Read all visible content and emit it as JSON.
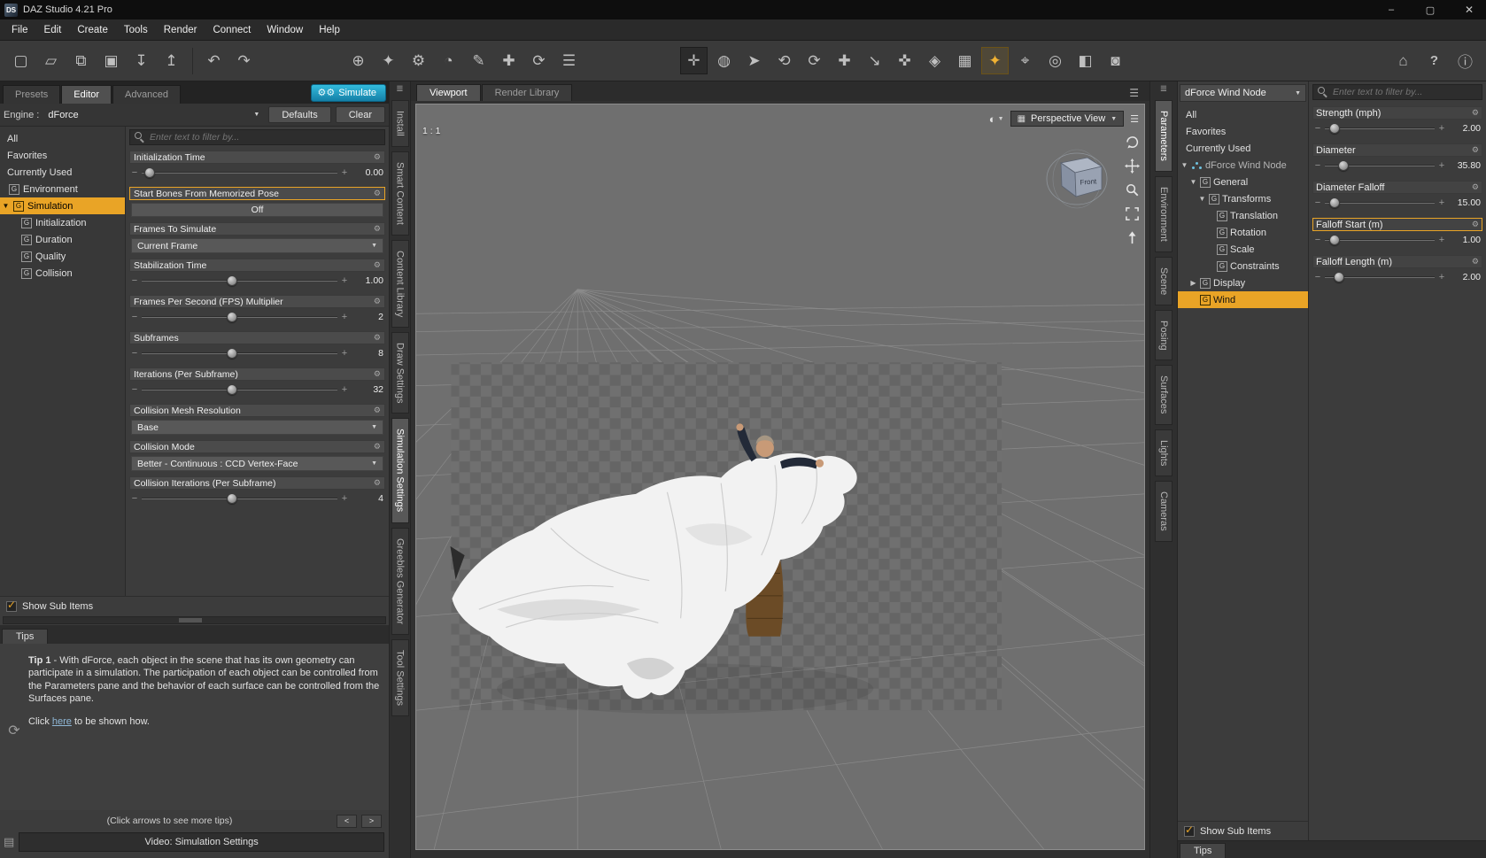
{
  "titlebar": {
    "logo": "DS",
    "title": "DAZ Studio 4.21 Pro"
  },
  "menubar": {
    "items": [
      "File",
      "Edit",
      "Create",
      "Tools",
      "Render",
      "Connect",
      "Window",
      "Help"
    ]
  },
  "toolbar": {
    "icon_names": [
      "new-file",
      "open-file",
      "merge-file",
      "save-file",
      "import",
      "export",
      "undo",
      "redo",
      "create-figure",
      "powerpose",
      "joint-editor",
      "timeline",
      "puppeteer",
      "measure-metrics",
      "refresh",
      "scene-list",
      "universal-tool",
      "drawstyle-sphere",
      "node-selection",
      "rotate-tool",
      "orbit-tool",
      "translate-tool",
      "scale-tool",
      "active-pose-tool",
      "dform-tool",
      "geometry-editor",
      "surface-selection",
      "spot-render",
      "region-navigator",
      "aim-tool",
      "render-settings",
      "render-camera",
      "daz-dashboard",
      "help",
      "info"
    ],
    "highlight_color": "#e9a426"
  },
  "left_pane": {
    "tabs": [
      "Presets",
      "Editor",
      "Advanced"
    ],
    "active_tab": "Editor",
    "simulate_label": "Simulate",
    "engine_label": "Engine :",
    "engine_value": "dForce",
    "defaults_label": "Defaults",
    "clear_label": "Clear",
    "categories": [
      "All",
      "Favorites",
      "Currently Used",
      "Environment",
      "Simulation",
      "Initialization",
      "Duration",
      "Quality",
      "Collision"
    ],
    "selected_category": "Simulation",
    "filter_placeholder": "Enter text to filter by...",
    "params": [
      {
        "label": "Initialization Time",
        "type": "slider",
        "value": "0.00"
      },
      {
        "label": "Start Bones From Memorized Pose",
        "type": "toggle",
        "value": "Off",
        "highlighted": true
      },
      {
        "label": "Frames To Simulate",
        "type": "dropdown",
        "value": "Current Frame"
      },
      {
        "label": "Stabilization Time",
        "type": "slider",
        "value": "1.00"
      },
      {
        "label": "Frames Per Second (FPS) Multiplier",
        "type": "slider",
        "value": "2"
      },
      {
        "label": "Subframes",
        "type": "slider",
        "value": "8"
      },
      {
        "label": "Iterations (Per Subframe)",
        "type": "slider",
        "value": "32"
      },
      {
        "label": "Collision Mesh Resolution",
        "type": "dropdown",
        "value": "Base"
      },
      {
        "label": "Collision Mode",
        "type": "dropdown",
        "value": "Better - Continuous : CCD Vertex-Face"
      },
      {
        "label": "Collision Iterations (Per Subframe)",
        "type": "slider",
        "value": "4"
      }
    ],
    "show_sub_items": "Show Sub Items",
    "tips": {
      "header": "Tips",
      "tip_title": "Tip 1",
      "tip_body": " - With dForce, each object in the scene that has its own geometry can participate in a simulation. The participation of each object can be controlled from the Parameters pane and the behavior of each surface can be controlled from the Surfaces pane.",
      "click_prefix": "Click ",
      "click_link": "here",
      "click_suffix": " to be shown how.",
      "arrows_hint": "(Click arrows to see more tips)",
      "prev_arrow": "<",
      "next_arrow": ">",
      "video_button": "Video: Simulation Settings"
    }
  },
  "left_tabstrip": {
    "tabs": [
      "Install",
      "Smart Content",
      "Content Library",
      "Draw Settings",
      "Simulation Settings",
      "Greebles Generator",
      "Tool Settings"
    ],
    "active": "Simulation Settings"
  },
  "viewport": {
    "tabs": [
      "Viewport",
      "Render Library"
    ],
    "active_tab": "Viewport",
    "ratio_label": "1 : 1",
    "view_selector": "Perspective View",
    "cube_front_label": "Front",
    "control_icons": [
      "orbit-view",
      "pan-view",
      "zoom-view",
      "frame-view",
      "reset-view"
    ]
  },
  "right_tabstrip": {
    "tabs": [
      "Parameters",
      "Environment",
      "Scene",
      "Posing",
      "Surfaces",
      "Lights",
      "Cameras"
    ],
    "active": "Parameters"
  },
  "parameters_pane": {
    "node_selector": "dForce Wind Node",
    "tree": [
      "All",
      "Favorites",
      "Currently Used",
      "dForce Wind Node",
      "General",
      "Transforms",
      "Translation",
      "Rotation",
      "Scale",
      "Constraints",
      "Display",
      "Wind"
    ],
    "selected_item": "Wind",
    "show_sub_items": "Show Sub Items",
    "filter_placeholder": "Enter text to filter by...",
    "sliders": [
      {
        "label": "Strength (mph)",
        "value": "2.00"
      },
      {
        "label": "Diameter",
        "value": "35.80"
      },
      {
        "label": "Diameter Falloff",
        "value": "15.00"
      },
      {
        "label": "Falloff Start (m)",
        "value": "1.00",
        "highlighted": true
      },
      {
        "label": "Falloff Length (m)",
        "value": "2.00"
      }
    ],
    "tips_label": "Tips"
  },
  "colors": {
    "accent_yellow": "#e9a426",
    "simulate_cyan": "#1ba3c9",
    "viewport_bg": "#6f6f6f"
  }
}
